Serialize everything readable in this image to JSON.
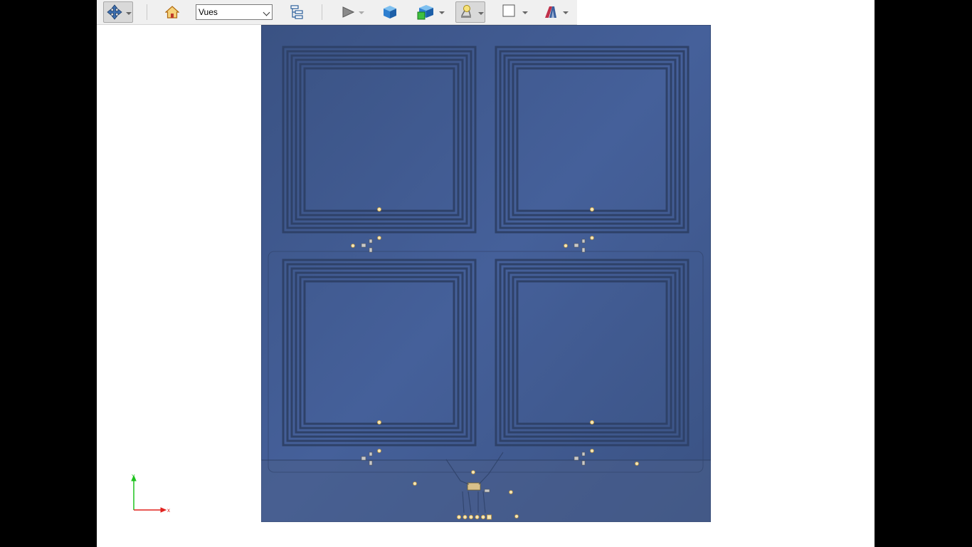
{
  "toolbar": {
    "view_selector": {
      "value": "Vues"
    },
    "tools": [
      {
        "name": "navigation-style-button",
        "icon": "move-cross-icon",
        "pressed": true
      },
      {
        "name": "home-view-button",
        "icon": "home-icon"
      },
      {
        "name": "tree-view-button",
        "icon": "tree-icon"
      },
      {
        "name": "play-animation-button",
        "icon": "play-icon"
      },
      {
        "name": "view-cube-button",
        "icon": "cube-icon"
      },
      {
        "name": "display-mode-button",
        "icon": "green-cube-icon"
      },
      {
        "name": "lighting-button",
        "icon": "lamp-icon",
        "pressed": true
      },
      {
        "name": "background-button",
        "icon": "square-icon"
      },
      {
        "name": "material-button",
        "icon": "material-icon"
      }
    ]
  },
  "scene": {
    "board_color": "#3f5789",
    "trace_color": "#2e4168",
    "coil_count": 4
  },
  "axis": {
    "x_label": "x",
    "y_label": "Y",
    "x_color": "#e0231f",
    "y_color": "#1ec21e"
  }
}
